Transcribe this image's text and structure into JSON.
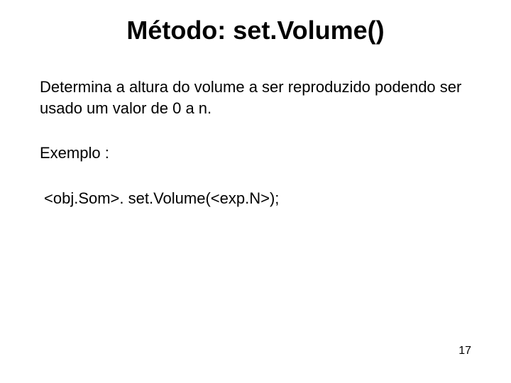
{
  "title": "Método: set.Volume()",
  "description": "Determina a altura do volume a ser reproduzido podendo ser usado um valor de 0 a n.",
  "example_label": "Exemplo :",
  "code": "<obj.Som>. set.Volume(<exp.N>);",
  "page_number": "17"
}
